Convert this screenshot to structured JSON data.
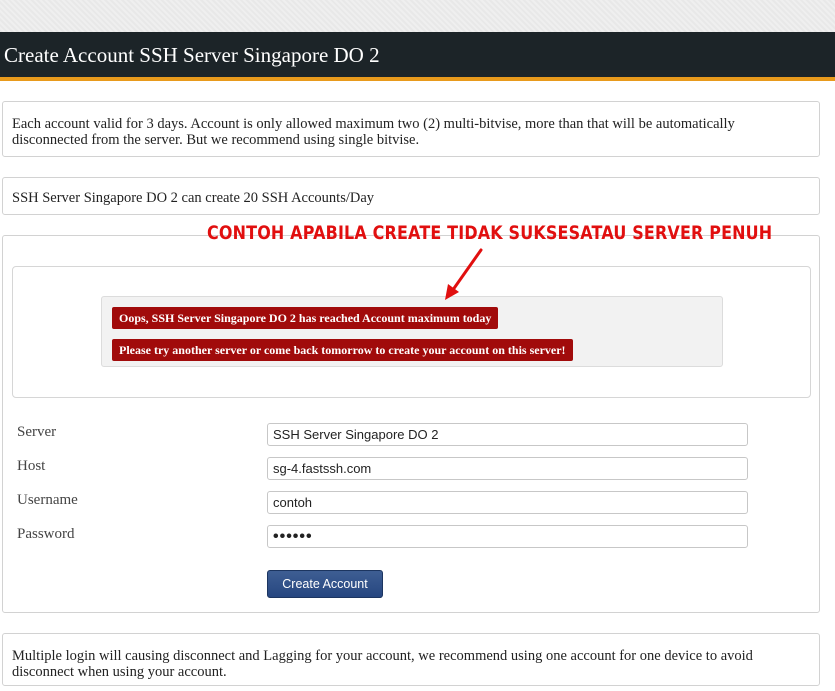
{
  "page": {
    "title": "Create Account SSH Server Singapore DO 2"
  },
  "info": {
    "validity": "Each account valid for 3 days. Account is only allowed maximum two (2) multi-bitvise, more than that will be automatically disconnected from the server. But we recommend using single bitvise.",
    "daily_limit": "SSH Server Singapore DO 2 can create 20 SSH Accounts/Day",
    "warning": "Multiple login will causing disconnect and Lagging for your account, we recommend using one account for one device to avoid disconnect when using your account."
  },
  "annotation": {
    "text": "CONTOH APABILA CREATE TIDAK SUKSESATAU SERVER PENUH",
    "color": "#e10f0f"
  },
  "alerts": [
    "Oops, SSH Server Singapore DO 2 has reached Account maximum today",
    "Please try another server or come back tomorrow to create your account on this server!"
  ],
  "form": {
    "server_label": "Server",
    "server_value": "SSH Server Singapore DO 2",
    "host_label": "Host",
    "host_value": "sg-4.fastssh.com",
    "username_label": "Username",
    "username_value": "contoh",
    "password_label": "Password",
    "password_value": "••••••",
    "submit_label": "Create Account"
  },
  "colors": {
    "header_bg": "#1c2428",
    "header_accent": "#e89a1c",
    "alert_bg": "#a10b0b",
    "button_bg": "#2c4b85"
  }
}
